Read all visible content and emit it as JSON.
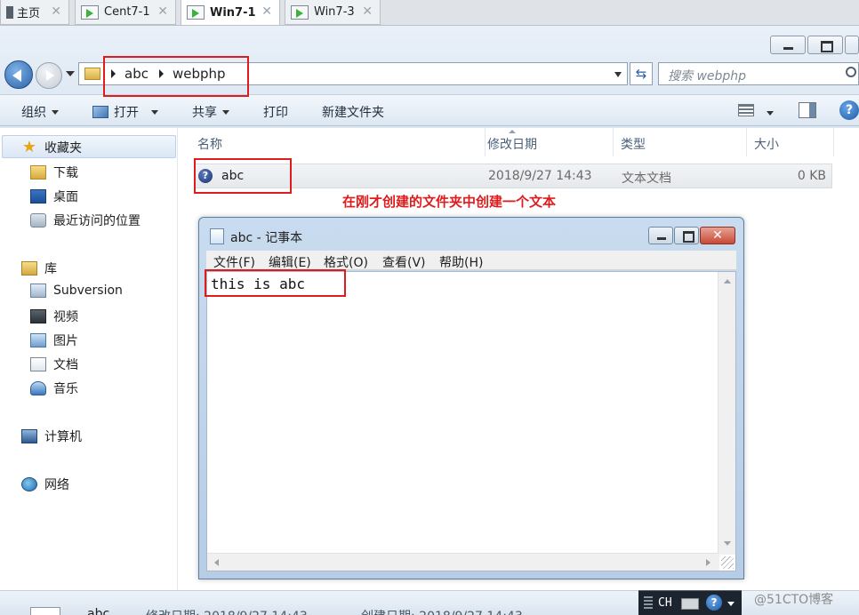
{
  "vm_tabs": [
    {
      "label": "主页",
      "active": false
    },
    {
      "label": "Cent7-1",
      "active": false
    },
    {
      "label": "Win7-1",
      "active": true
    },
    {
      "label": "Win7-3",
      "active": false
    }
  ],
  "address": {
    "crumbs": [
      "abc",
      "webphp"
    ]
  },
  "search": {
    "placeholder": "搜索 webphp"
  },
  "toolbar": {
    "organize": "组织",
    "open": "打开",
    "share": "共享",
    "print": "打印",
    "new_folder": "新建文件夹",
    "help": "?"
  },
  "nav": {
    "favorites": "收藏夹",
    "downloads": "下载",
    "desktop": "桌面",
    "recent": "最近访问的位置",
    "libraries": "库",
    "subversion": "Subversion",
    "videos": "视频",
    "pictures": "图片",
    "documents": "文档",
    "music": "音乐",
    "computer": "计算机",
    "network": "网络"
  },
  "columns": {
    "name": "名称",
    "modified": "修改日期",
    "type": "类型",
    "size": "大小"
  },
  "files": [
    {
      "name": "abc",
      "modified": "2018/9/27 14:43",
      "type": "文本文档",
      "size": "0 KB"
    }
  ],
  "annotation": "在刚才创建的文件夹中创建一个文本",
  "notepad": {
    "title": "abc - 记事本",
    "menus": [
      "文件(F)",
      "编辑(E)",
      "格式(O)",
      "查看(V)",
      "帮助(H)"
    ],
    "content": "this is abc"
  },
  "details": {
    "name": "abc",
    "modified": "修改日期: 2018/9/27 14:43",
    "created": "创建日期: 2018/9/27 14:43"
  },
  "tray": {
    "lang": "CH"
  },
  "watermark": "@51CTO博客",
  "colors": {
    "annotation_red": "#e01b1b",
    "accent_blue": "#2c5fa8"
  }
}
